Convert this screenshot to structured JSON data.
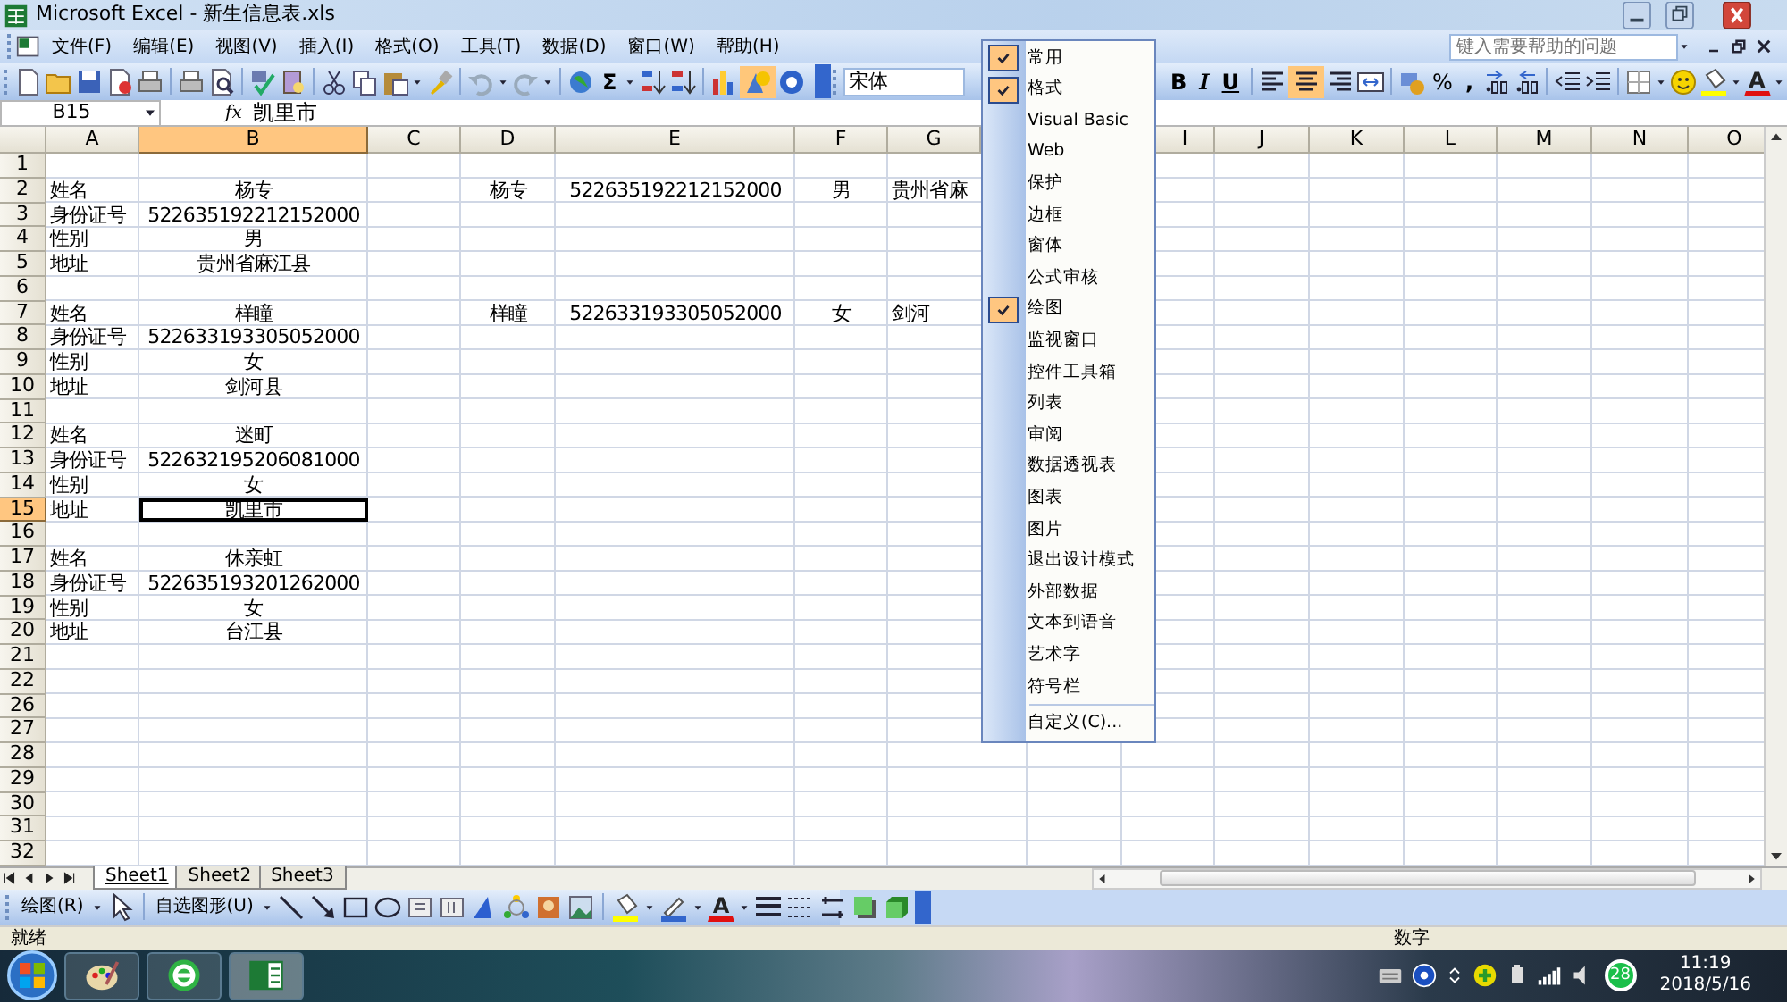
{
  "window": {
    "title": "Microsoft Excel - 新生信息表.xls"
  },
  "menu_bar": {
    "items": [
      "文件(F)",
      "编辑(E)",
      "视图(V)",
      "插入(I)",
      "格式(O)",
      "工具(T)",
      "数据(D)",
      "窗口(W)",
      "帮助(H)"
    ],
    "help_placeholder": "键入需要帮助的问题"
  },
  "standard_toolbar": {
    "sum_label": "Σ",
    "drawing_active": true
  },
  "formatting_toolbar": {
    "font": "宋体",
    "bold": "B",
    "italic": "I",
    "underline": "U",
    "center_active": true,
    "percent": "%",
    "comma": ",",
    "font_color": "A"
  },
  "formula_bar": {
    "name_box": "B15",
    "fx": "fx",
    "value": "凯里市"
  },
  "sheet": {
    "columns": [
      {
        "label": "A",
        "selected": false
      },
      {
        "label": "B",
        "selected": true
      },
      {
        "label": "C",
        "selected": false
      },
      {
        "label": "D",
        "selected": false
      },
      {
        "label": "E",
        "selected": false
      },
      {
        "label": "F",
        "selected": false
      },
      {
        "label": "G",
        "selected": false
      },
      {
        "label": "I",
        "selected": false
      },
      {
        "label": "J",
        "selected": false
      },
      {
        "label": "K",
        "selected": false
      },
      {
        "label": "L",
        "selected": false
      },
      {
        "label": "M",
        "selected": false
      },
      {
        "label": "N",
        "selected": false
      },
      {
        "label": "O",
        "selected": false
      }
    ],
    "rows": [
      {
        "label": "1",
        "selected": false
      },
      {
        "label": "2",
        "selected": false,
        "A": "姓名",
        "B": "杨专",
        "D": "杨专",
        "E": "522635192212152000",
        "F": "男",
        "G": "贵州省麻"
      },
      {
        "label": "3",
        "selected": false,
        "A": "身份证号",
        "B": "522635192212152000"
      },
      {
        "label": "4",
        "selected": false,
        "A": "性别",
        "B": "男"
      },
      {
        "label": "5",
        "selected": false,
        "A": "地址",
        "B": "贵州省麻江县"
      },
      {
        "label": "6",
        "selected": false
      },
      {
        "label": "7",
        "selected": false,
        "A": "姓名",
        "B": "样瞳",
        "D": "样瞳",
        "E": "522633193305052000",
        "F": "女",
        "G": "剑河"
      },
      {
        "label": "8",
        "selected": false,
        "A": "身份证号",
        "B": "522633193305052000"
      },
      {
        "label": "9",
        "selected": false,
        "A": "性别",
        "B": "女"
      },
      {
        "label": "10",
        "selected": false,
        "A": "地址",
        "B": "剑河县"
      },
      {
        "label": "11",
        "selected": false
      },
      {
        "label": "12",
        "selected": false,
        "A": "姓名",
        "B": "迷町"
      },
      {
        "label": "13",
        "selected": false,
        "A": "身份证号",
        "B": "522632195206081000"
      },
      {
        "label": "14",
        "selected": false,
        "A": "性别",
        "B": "女"
      },
      {
        "label": "15",
        "selected": true,
        "A": "地址",
        "B": "凯里市"
      },
      {
        "label": "16",
        "selected": false
      },
      {
        "label": "17",
        "selected": false,
        "A": "姓名",
        "B": "休亲虹"
      },
      {
        "label": "18",
        "selected": false,
        "A": "身份证号",
        "B": "522635193201262000"
      },
      {
        "label": "19",
        "selected": false,
        "A": "性别",
        "B": "女"
      },
      {
        "label": "20",
        "selected": false,
        "A": "地址",
        "B": "台江县"
      },
      {
        "label": "21",
        "selected": false
      },
      {
        "label": "22",
        "selected": false
      },
      {
        "label": "26",
        "selected": false
      },
      {
        "label": "27",
        "selected": false
      },
      {
        "label": "28",
        "selected": false
      },
      {
        "label": "29",
        "selected": false
      },
      {
        "label": "30",
        "selected": false
      },
      {
        "label": "31",
        "selected": false
      },
      {
        "label": "32",
        "selected": false
      }
    ]
  },
  "sheet_tabs": [
    {
      "label": "Sheet1",
      "selected": true
    },
    {
      "label": "Sheet2",
      "selected": false
    },
    {
      "label": "Sheet3",
      "selected": false
    }
  ],
  "drawing_toolbar": {
    "draw_menu": "绘图(R)",
    "autoshapes": "自选图形(U)",
    "font_color": "A"
  },
  "status_bar": {
    "left": "就绪",
    "right": "数字"
  },
  "toolbar_menu": {
    "items": [
      {
        "label": "常用",
        "kind": "toggle",
        "checked": true
      },
      {
        "label": "格式",
        "kind": "toggle",
        "checked": true
      },
      {
        "label": "Visual Basic",
        "kind": "toggle",
        "checked": false
      },
      {
        "label": "Web",
        "kind": "toggle",
        "checked": false
      },
      {
        "label": "保护",
        "kind": "toggle",
        "checked": false
      },
      {
        "label": "边框",
        "kind": "toggle",
        "checked": false
      },
      {
        "label": "窗体",
        "kind": "toggle",
        "checked": false
      },
      {
        "label": "公式审核",
        "kind": "toggle",
        "checked": false
      },
      {
        "label": "绘图",
        "kind": "toggle",
        "checked": true
      },
      {
        "label": "监视窗口",
        "kind": "toggle",
        "checked": false
      },
      {
        "label": "控件工具箱",
        "kind": "toggle",
        "checked": false
      },
      {
        "label": "列表",
        "kind": "toggle",
        "checked": false
      },
      {
        "label": "审阅",
        "kind": "toggle",
        "checked": false
      },
      {
        "label": "数据透视表",
        "kind": "toggle",
        "checked": false
      },
      {
        "label": "图表",
        "kind": "toggle",
        "checked": false
      },
      {
        "label": "图片",
        "kind": "toggle",
        "checked": false
      },
      {
        "label": "退出设计模式",
        "kind": "toggle",
        "checked": false
      },
      {
        "label": "外部数据",
        "kind": "toggle",
        "checked": false
      },
      {
        "label": "文本到语音",
        "kind": "toggle",
        "checked": false
      },
      {
        "label": "艺术字",
        "kind": "toggle",
        "checked": false
      },
      {
        "label": "符号栏",
        "kind": "toggle",
        "checked": false
      },
      {
        "label": "自定义(C)...",
        "kind": "command",
        "checked": false
      }
    ]
  },
  "taskbar": {
    "badge": "28",
    "time": "11:19",
    "date": "2018/5/16"
  }
}
